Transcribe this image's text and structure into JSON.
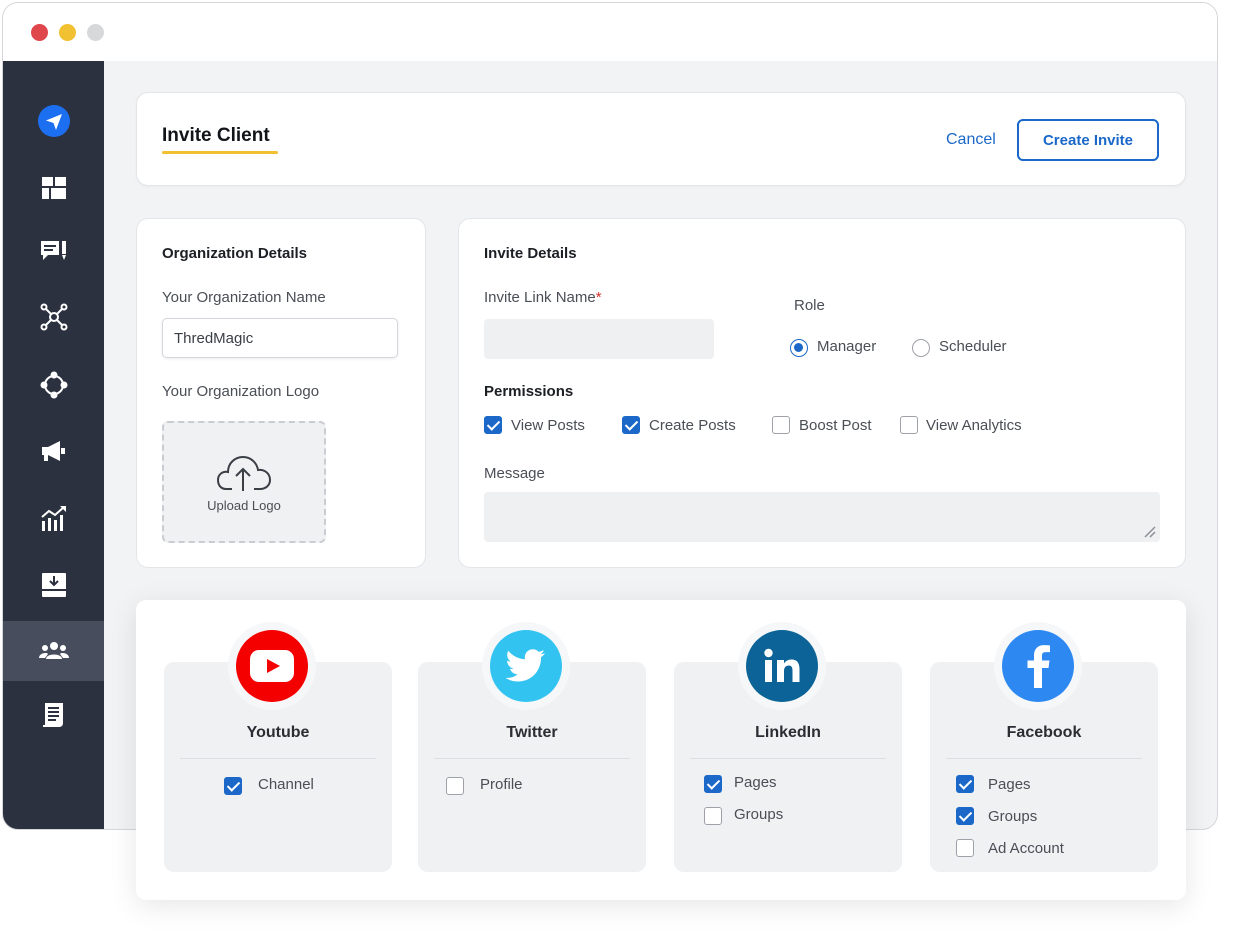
{
  "colors": {
    "accent": "#1b68c9",
    "sidebar": "#2c3140",
    "underline": "#f2c132"
  },
  "sidebar": {
    "items": [
      {
        "icon": "paper-plane-icon",
        "active": false
      },
      {
        "icon": "dashboard-icon",
        "active": false
      },
      {
        "icon": "comments-icon",
        "active": false
      },
      {
        "icon": "network-icon",
        "active": false
      },
      {
        "icon": "connections-icon",
        "active": false
      },
      {
        "icon": "megaphone-icon",
        "active": false
      },
      {
        "icon": "analytics-icon",
        "active": false
      },
      {
        "icon": "inbox-download-icon",
        "active": false
      },
      {
        "icon": "team-icon",
        "active": true
      },
      {
        "icon": "document-icon",
        "active": false
      }
    ]
  },
  "header": {
    "title": "Invite Client",
    "cancel_label": "Cancel",
    "create_label": "Create Invite"
  },
  "organization": {
    "section_title": "Organization Details",
    "name_label": "Your Organization Name",
    "name_value": "ThredMagic",
    "logo_label": "Your Organization Logo",
    "upload_label": "Upload Logo"
  },
  "invite": {
    "section_title": "Invite Details",
    "link_name_label": "Invite Link Name",
    "required_mark": "*",
    "role_label": "Role",
    "roles": [
      {
        "label": "Manager",
        "selected": true
      },
      {
        "label": "Scheduler",
        "selected": false
      }
    ],
    "permissions_label": "Permissions",
    "permissions": [
      {
        "label": "View Posts",
        "checked": true
      },
      {
        "label": "Create Posts",
        "checked": true
      },
      {
        "label": "Boost Post",
        "checked": false
      },
      {
        "label": "View Analytics",
        "checked": false
      }
    ],
    "message_label": "Message"
  },
  "socials": [
    {
      "name": "Youtube",
      "icon": "youtube-icon",
      "color": "#f50000",
      "options": [
        {
          "label": "Channel",
          "checked": true
        }
      ]
    },
    {
      "name": "Twitter",
      "icon": "twitter-icon",
      "color": "#33c3f0",
      "options": [
        {
          "label": "Profile",
          "checked": false
        }
      ]
    },
    {
      "name": "LinkedIn",
      "icon": "linkedin-icon",
      "color": "#0b6397",
      "options": [
        {
          "label": "Pages",
          "checked": true
        },
        {
          "label": "Groups",
          "checked": false
        }
      ]
    },
    {
      "name": "Facebook",
      "icon": "facebook-icon",
      "color": "#2d88f2",
      "options": [
        {
          "label": "Pages",
          "checked": true
        },
        {
          "label": "Groups",
          "checked": true
        },
        {
          "label": "Ad Account",
          "checked": false
        }
      ]
    }
  ]
}
